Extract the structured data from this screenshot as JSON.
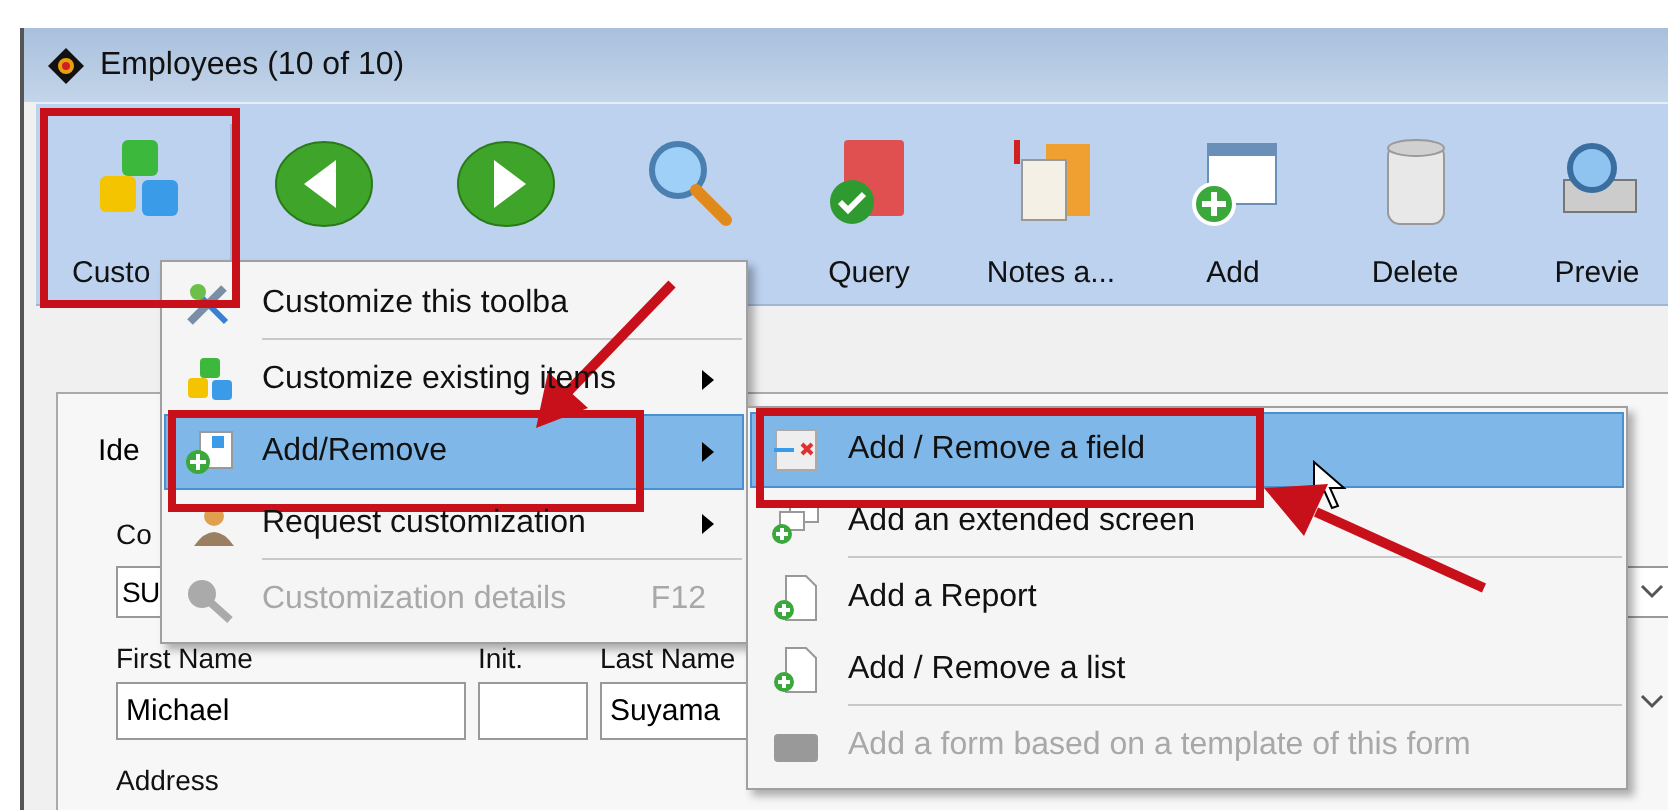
{
  "window": {
    "title": "Employees (10 of 10)"
  },
  "toolbar": [
    {
      "kind": "customize",
      "label": "Custo"
    },
    {
      "kind": "back"
    },
    {
      "kind": "forward"
    },
    {
      "kind": "search"
    },
    {
      "kind": "query",
      "label": "Query"
    },
    {
      "kind": "notes",
      "label": "Notes a..."
    },
    {
      "kind": "add",
      "label": "Add"
    },
    {
      "kind": "delete",
      "label": "Delete"
    },
    {
      "kind": "preview",
      "label": "Previe"
    }
  ],
  "form": {
    "tab": "Ide",
    "row1": {
      "label": "Co",
      "value": "SU"
    },
    "row2": [
      {
        "label": "First Name",
        "value": "Michael"
      },
      {
        "label": "Init."
      },
      {
        "label": "Last Name",
        "value": "Suyama"
      }
    ],
    "row3_label": "Address"
  },
  "context_menu": [
    {
      "kind": "tools",
      "label": "Customize this toolba",
      "selected": false,
      "disabled": false,
      "submenu": false,
      "separator_after": true
    },
    {
      "kind": "cubes",
      "label": "Customize existing items",
      "selected": false,
      "disabled": false,
      "submenu": true,
      "separator_after": false
    },
    {
      "kind": "add",
      "label": "Add/Remove",
      "selected": true,
      "disabled": false,
      "submenu": true,
      "separator_after": false
    },
    {
      "kind": "person",
      "label": "Request customization",
      "selected": false,
      "disabled": false,
      "submenu": true,
      "separator_after": true
    },
    {
      "kind": "key",
      "label": "Customization details",
      "shortcut": "F12",
      "selected": false,
      "disabled": true,
      "submenu": false,
      "separator_after": false
    }
  ],
  "submenu": [
    {
      "kind": "field",
      "label": "Add / Remove a field",
      "selected": true,
      "disabled": false,
      "separator_after": false
    },
    {
      "kind": "screen",
      "label": "Add an extended screen",
      "selected": false,
      "disabled": false,
      "separator_after": true
    },
    {
      "kind": "doc",
      "label": "Add a Report",
      "selected": false,
      "disabled": false,
      "separator_after": false
    },
    {
      "kind": "doc",
      "label": "Add / Remove a list",
      "selected": false,
      "disabled": false,
      "separator_after": true
    },
    {
      "kind": "form",
      "label": "Add a form based on a template of this form",
      "selected": false,
      "disabled": true,
      "separator_after": false
    }
  ]
}
